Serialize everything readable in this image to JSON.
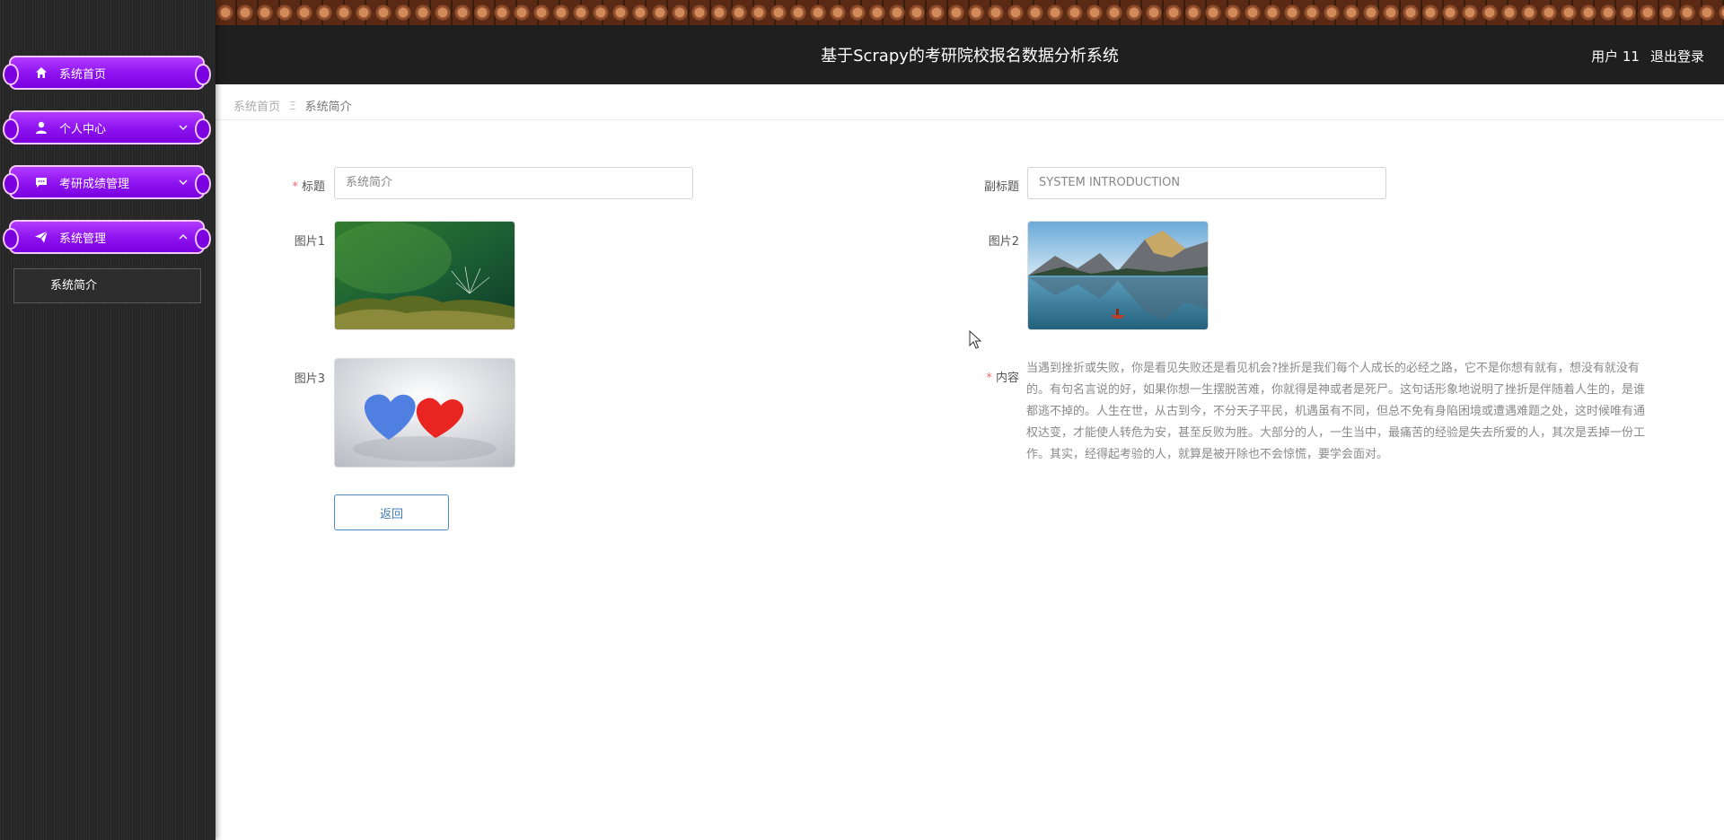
{
  "header": {
    "title": "基于Scrapy的考研院校报名数据分析系统",
    "user": "用户 11",
    "logout": "退出登录"
  },
  "sidebar": {
    "items": [
      {
        "label": "系统首页",
        "icon": "home-icon"
      },
      {
        "label": "个人中心",
        "icon": "user-icon",
        "arrow": "down"
      },
      {
        "label": "考研成绩管理",
        "icon": "chat-icon",
        "arrow": "down"
      },
      {
        "label": "系统管理",
        "icon": "send-icon",
        "arrow": "up"
      }
    ],
    "submenu": [
      {
        "label": "系统简介"
      }
    ]
  },
  "breadcrumb": {
    "home": "系统首页",
    "separator": "Ξ",
    "current": "系统简介"
  },
  "form": {
    "title_label": "标题",
    "title_value": "系统简介",
    "subtitle_label": "副标题",
    "subtitle_value": "SYSTEM INTRODUCTION",
    "pic1_label": "图片1",
    "pic2_label": "图片2",
    "pic3_label": "图片3",
    "content_label": "内容",
    "content_value": "当遇到挫折或失败，你是看见失败还是看见机会?挫折是我们每个人成长的必经之路，它不是你想有就有，想没有就没有的。有句名言说的好，如果你想一生摆脱苦难，你就得是神或者是死尸。这句话形象地说明了挫折是伴随着人生的，是谁都逃不掉的。人生在世，从古到今，不分天子平民，机遇虽有不同，但总不免有身陷困境或遭遇难题之处，这时候唯有通权达变，才能使人转危为安，甚至反败为胜。大部分的人，一生当中，最痛苦的经验是失去所爱的人，其次是丢掉一份工作。其实，经得起考验的人，就算是被开除也不会惊慌，要学会面对。",
    "back_button": "返回"
  },
  "colors": {
    "menu_purple": "#8c12ef",
    "menu_border": "#f3c8ff",
    "sidebar_bg": "#262626",
    "header_bg": "#1f1f1f",
    "required": "#f56c6c",
    "button_border": "#4e8ac2"
  }
}
